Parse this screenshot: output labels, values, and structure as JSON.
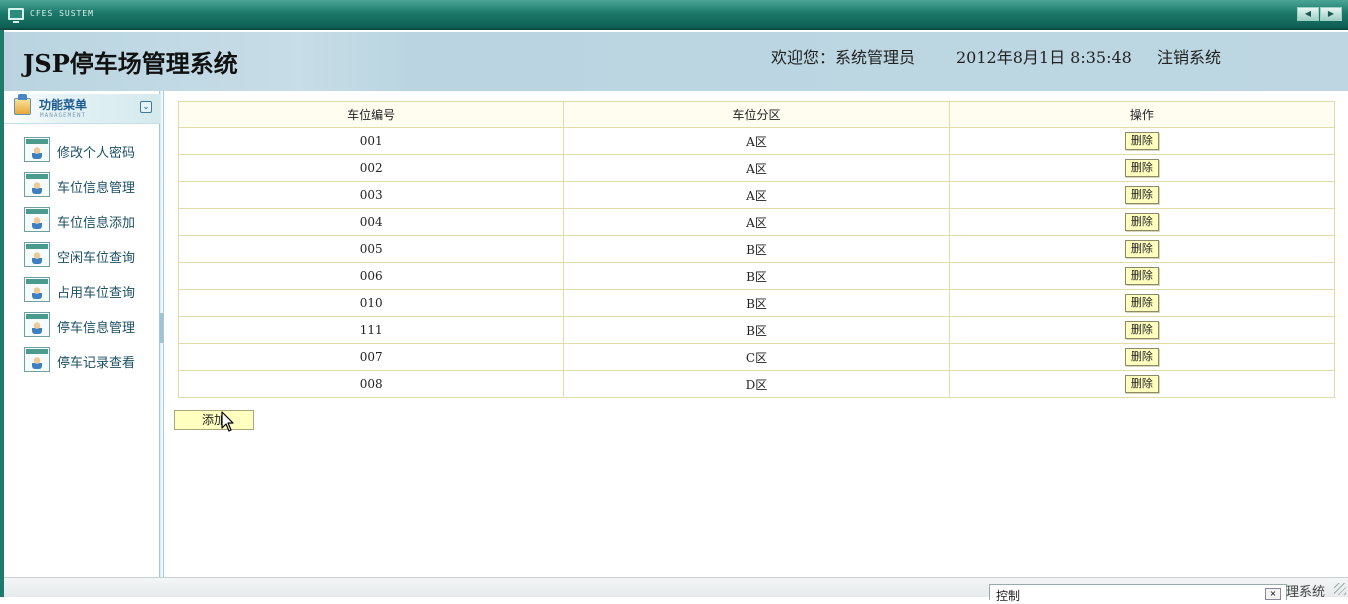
{
  "window": {
    "title": "CFES SUSTEM",
    "prev_symbol": "◀",
    "next_symbol": "▶"
  },
  "header": {
    "title": "JSP停车场管理系统",
    "welcome": "欢迎您：系统管理员",
    "datetime": "2012年8月1日  8:35:48",
    "logout": "注销系统"
  },
  "sidebar": {
    "title": "功能菜单",
    "subtitle": "MANAGEMENT",
    "collapse_symbol": "⌄",
    "items": [
      {
        "label": "修改个人密码"
      },
      {
        "label": "车位信息管理"
      },
      {
        "label": "车位信息添加"
      },
      {
        "label": "空闲车位查询"
      },
      {
        "label": "占用车位查询"
      },
      {
        "label": "停车信息管理"
      },
      {
        "label": "停车记录查看"
      }
    ]
  },
  "table": {
    "headers": [
      "车位编号",
      "车位分区",
      "操作"
    ],
    "delete_label": "删除",
    "rows": [
      {
        "id": "001",
        "zone": "A区"
      },
      {
        "id": "002",
        "zone": "A区"
      },
      {
        "id": "003",
        "zone": "A区"
      },
      {
        "id": "004",
        "zone": "A区"
      },
      {
        "id": "005",
        "zone": "B区"
      },
      {
        "id": "006",
        "zone": "B区"
      },
      {
        "id": "010",
        "zone": "B区"
      },
      {
        "id": "111",
        "zone": "B区"
      },
      {
        "id": "007",
        "zone": "C区"
      },
      {
        "id": "008",
        "zone": "D区"
      }
    ]
  },
  "add_label": "添加",
  "statusbar": {
    "task_label": "控制",
    "task_btn": "×",
    "right_text": "理系统"
  },
  "colors": {
    "header_bg": "#bdd6e2",
    "button_bg": "#ffffc0",
    "table_border": "#e4dca8",
    "window_bar": "#1d7a6b"
  }
}
